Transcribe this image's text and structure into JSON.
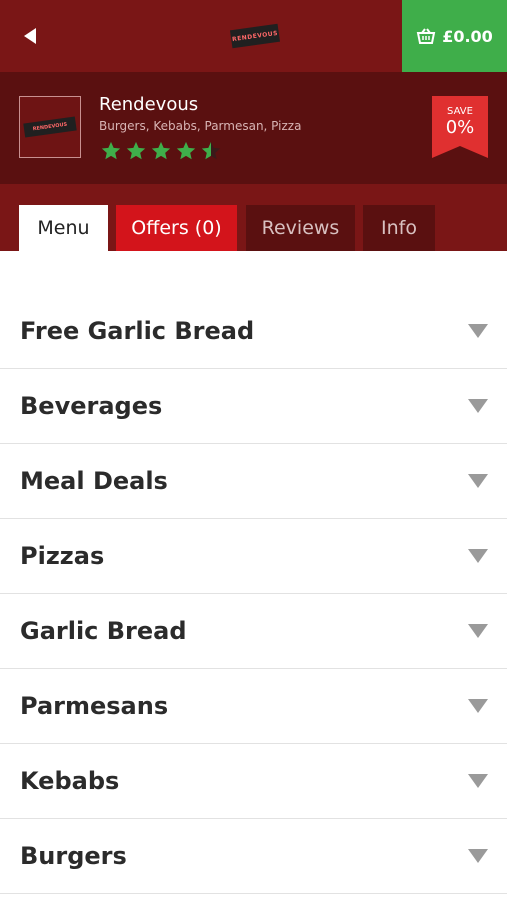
{
  "topbar": {
    "cart_total": "£0.00",
    "logo_text": "RENDEVOUS"
  },
  "restaurant": {
    "name": "Rendevous",
    "cuisines": "Burgers, Kebabs, Parmesan, Pizza",
    "rating": 4.5,
    "logo_text": "RENDEVOUS",
    "save_label": "SAVE",
    "save_value": "0%"
  },
  "tabs": [
    {
      "label": "Menu"
    },
    {
      "label": "Offers (0)"
    },
    {
      "label": "Reviews"
    },
    {
      "label": "Info"
    }
  ],
  "menu": [
    {
      "label": "Free Garlic Bread"
    },
    {
      "label": "Beverages"
    },
    {
      "label": "Meal Deals"
    },
    {
      "label": "Pizzas"
    },
    {
      "label": "Garlic Bread"
    },
    {
      "label": "Parmesans"
    },
    {
      "label": "Kebabs"
    },
    {
      "label": "Burgers"
    }
  ],
  "colors": {
    "topbar": "#7a1616",
    "header": "#5a1010",
    "cart": "#3fae4a",
    "offers_tab": "#d3141b",
    "star": "#3fae4a"
  },
  "icons": {
    "back": "back-arrow-icon",
    "cart": "basket-icon",
    "expand": "chevron-down-icon"
  }
}
